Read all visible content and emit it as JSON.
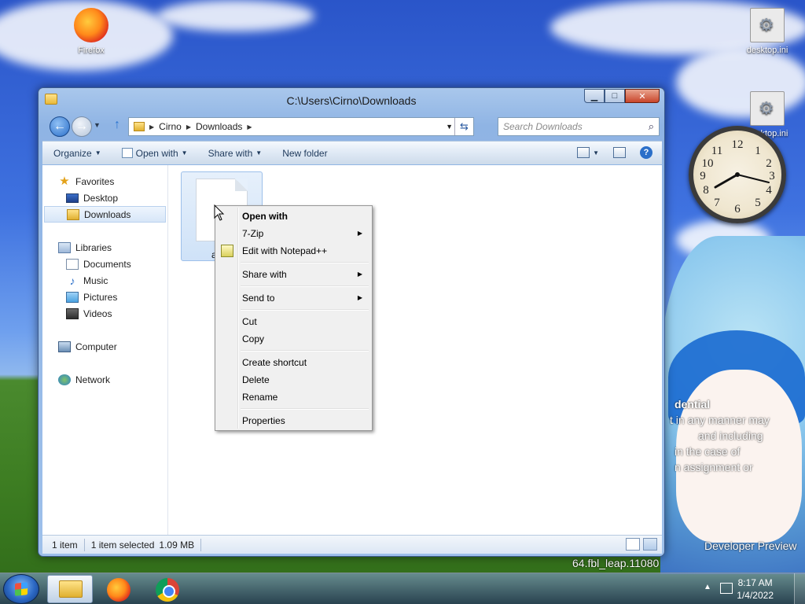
{
  "desktop": {
    "icons": [
      {
        "label": "Firefox",
        "icon": "firefox-icon"
      },
      {
        "label": "desktop.ini",
        "icon": "ini-file-icon"
      },
      {
        "label": "desktop.ini",
        "icon": "ini-file-icon"
      }
    ],
    "wallpaper_text": [
      "dential",
      "t in any manner may",
      "and including",
      "in the case of",
      "n assignment or",
      "Developer Preview",
      "64.fbl_leap.11080"
    ]
  },
  "clock": {
    "time": "8:17"
  },
  "window": {
    "title": "C:\\Users\\Cirno\\Downloads",
    "breadcrumb": [
      "Cirno",
      "Downloads"
    ],
    "search_placeholder": "Search Downloads",
    "toolbar": {
      "organize": "Organize",
      "open_with": "Open with",
      "share_with": "Share with",
      "new_folder": "New folder"
    },
    "nav": {
      "favorites": "Favorites",
      "desktop": "Desktop",
      "downloads": "Downloads",
      "libraries": "Libraries",
      "documents": "Documents",
      "music": "Music",
      "pictures": "Pictures",
      "videos": "Videos",
      "computer": "Computer",
      "network": "Network"
    },
    "file": {
      "name_visible": "a"
    },
    "status": {
      "count": "1 item",
      "selected": "1 item selected",
      "size": "1.09 MB"
    }
  },
  "context_menu": {
    "open_with": "Open with",
    "seven_zip": "7-Zip",
    "edit_notepad": "Edit with Notepad++",
    "share_with": "Share with",
    "send_to": "Send to",
    "cut": "Cut",
    "copy": "Copy",
    "create_shortcut": "Create shortcut",
    "delete": "Delete",
    "rename": "Rename",
    "properties": "Properties"
  },
  "taskbar": {
    "time": "8:17 AM",
    "date": "1/4/2022"
  }
}
